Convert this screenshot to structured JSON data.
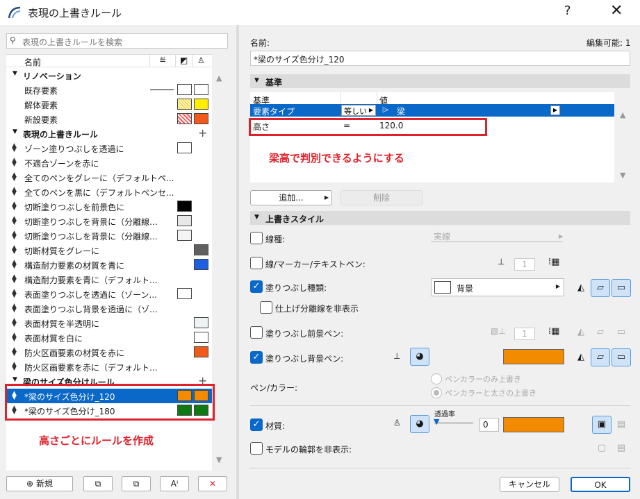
{
  "window": {
    "title": "表現の上書きルール",
    "help": "?",
    "close": "✕"
  },
  "left": {
    "search_placeholder": "表現の上書きルールを検索",
    "header": {
      "name": "名前"
    },
    "groups": [
      {
        "label": "リノベーション",
        "items": [
          {
            "label": "既存要素",
            "swatch_a": "#ffffff",
            "swatch_b": "#ffffff",
            "line": true
          },
          {
            "label": "解体要素",
            "swatch_a": "#fff6a0",
            "swatch_b": "#ffee00"
          },
          {
            "label": "新設要素",
            "swatch_a": "#ff9a9a",
            "swatch_b": "#f05a1a"
          }
        ]
      },
      {
        "label": "表現の上書きルール",
        "items": [
          {
            "label": "ゾーン塗りつぶしを透過に",
            "swatch_a": "#ffffff"
          },
          {
            "label": "不適合ゾーンを赤に"
          },
          {
            "label": "全てのペンをグレーに（デフォルトペ..."
          },
          {
            "label": "全てのペンを黒に（デフォルトペンセ..."
          },
          {
            "label": "切断塗りつぶしを前景色に",
            "swatch_a": "#000000"
          },
          {
            "label": "切断塗りつぶしを背景に（分離線...",
            "swatch_a": "#e8e8e8"
          },
          {
            "label": "切断塗りつぶしを背景に（分離線...",
            "swatch_a": "#f4f4f4"
          },
          {
            "label": "切断材質をグレーに",
            "swatch_b": "#606060"
          },
          {
            "label": "構造耐力要素の材質を青に",
            "swatch_b": "#1e5ee0"
          },
          {
            "label": "構造耐力要素を青に（デフォルト..."
          },
          {
            "label": "表面塗りつぶしを透過に（ゾーン...",
            "swatch_a": "#ffffff"
          },
          {
            "label": "表面塗りつぶし背景を透過に（ゾ..."
          },
          {
            "label": "表面材質を半透明に",
            "swatch_b": "#eef3f3"
          },
          {
            "label": "表面材質を白に",
            "swatch_b": "#ffffff"
          },
          {
            "label": "防火区画要素の材質を赤に",
            "swatch_b": "#f05a1a"
          },
          {
            "label": "防火区画要素を赤に（デフォルト..."
          }
        ]
      },
      {
        "label": "梁のサイズ色分けルール",
        "items": [
          {
            "label": "*梁のサイズ色分け_120",
            "swatch_a": "#f28b00",
            "swatch_b": "#f28b00",
            "selected": true
          },
          {
            "label": "*梁のサイズ色分け_180",
            "swatch_a": "#0f7a14",
            "swatch_b": "#0f7a14"
          }
        ]
      }
    ],
    "annotation": "高さごとにルールを作成",
    "buttons": {
      "new": "新規",
      "new_icon": "⊕"
    }
  },
  "right": {
    "name_label": "名前:",
    "editable": "編集可能: 1",
    "name_value": "*梁のサイズ色分け_120",
    "criteria_title": "基準",
    "criteria_cols": {
      "c1": "基準",
      "c3": "値"
    },
    "criteria_rows": [
      {
        "criterion": "要素タイプ",
        "op": "等しい",
        "value": "梁"
      },
      {
        "criterion": "高さ",
        "op": "=",
        "value": "120.0"
      }
    ],
    "annotation": "梁高で判別できるようにする",
    "add_button": "追加...",
    "delete_button": "削除",
    "style_title": "上書きスタイル",
    "line_type": {
      "label": "線種:",
      "value": "実線"
    },
    "line_pen": {
      "label": "線/マーカー/テキストペン:",
      "pen": "1"
    },
    "fill_type": {
      "label": "塗りつぶし種類:",
      "value": "背景"
    },
    "hide_sep": {
      "label": "仕上げ分離線を非表示"
    },
    "fill_fg": {
      "label": "塗りつぶし前景ペン:",
      "pen": "1"
    },
    "fill_bg": {
      "label": "塗りつぶし背景ペン:"
    },
    "pen_color": {
      "label": "ペン/カラー:",
      "opt1": "ペンカラーのみ上書き",
      "opt2": "ペンカラーと太さの上書き"
    },
    "material": {
      "label": "材質:",
      "transparency_label": "透過率",
      "transparency_value": "0"
    },
    "hide_contour": {
      "label": "モデルの輪郭を非表示:"
    },
    "cancel": "キャンセル",
    "ok": "OK",
    "accent": "#0a68c8",
    "swatch": "#f28b00"
  }
}
